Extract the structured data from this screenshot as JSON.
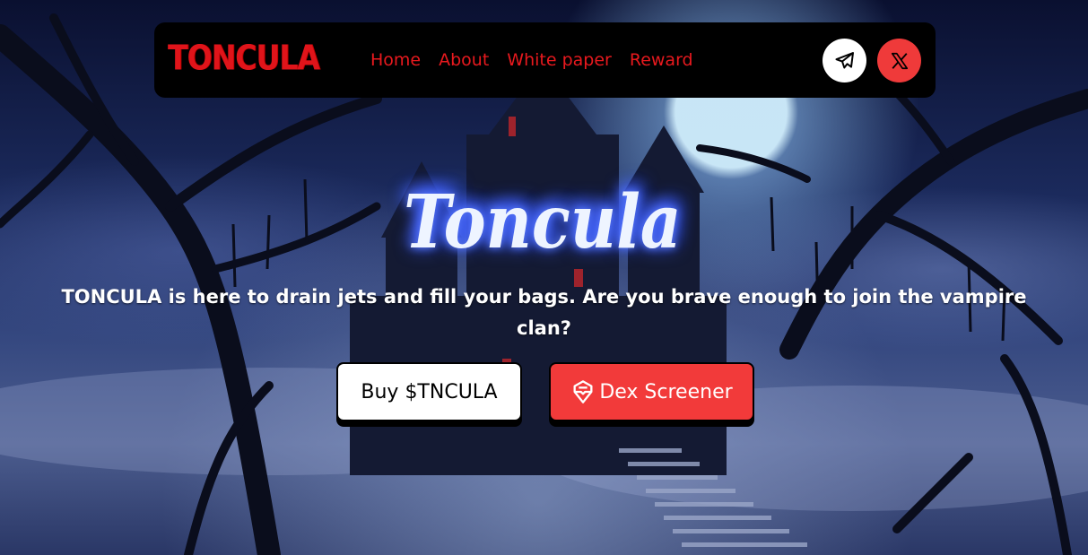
{
  "nav": {
    "brand": "TONCULA",
    "links": [
      {
        "label": "Home"
      },
      {
        "label": "About"
      },
      {
        "label": "White paper"
      },
      {
        "label": "Reward"
      }
    ],
    "social": [
      {
        "icon": "telegram-icon",
        "color": "#ffffff"
      },
      {
        "icon": "x-icon",
        "color": "#ef3a3a"
      }
    ]
  },
  "hero": {
    "logo_text": "Toncula",
    "tagline": "TONCULA is here to drain jets and fill your bags. Are you brave enough to join the vampire clan?",
    "buttons": {
      "buy": "Buy $TNCULA",
      "dex": "Dex Screener"
    }
  },
  "colors": {
    "accent_red": "#e8191e",
    "button_red": "#f23a3a",
    "nav_bg": "#000000"
  }
}
